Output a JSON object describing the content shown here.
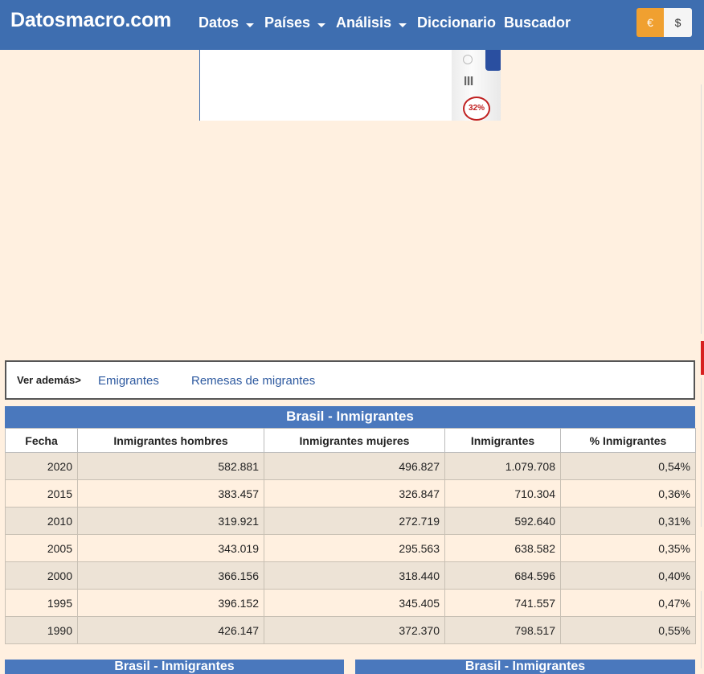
{
  "header": {
    "brand": "Datosmacro.com",
    "nav": [
      {
        "label": "Datos",
        "has_caret": true
      },
      {
        "label": "Países",
        "has_caret": true
      },
      {
        "label": "Análisis",
        "has_caret": true
      },
      {
        "label": "Diccionario",
        "has_caret": false
      },
      {
        "label": "Buscador",
        "has_caret": false
      }
    ],
    "currency": {
      "eur": "€",
      "usd": "$",
      "selected": "€"
    }
  },
  "ad": {
    "badge": "32%"
  },
  "see_also": {
    "label": "Ver además>",
    "links": [
      "Emigrantes",
      "Remesas de migrantes"
    ]
  },
  "table": {
    "title": "Brasil - Inmigrantes",
    "headers": [
      "Fecha",
      "Inmigrantes hombres",
      "Inmigrantes mujeres",
      "Inmigrantes",
      "% Inmigrantes"
    ],
    "rows": [
      [
        "2020",
        "582.881",
        "496.827",
        "1.079.708",
        "0,54%"
      ],
      [
        "2015",
        "383.457",
        "326.847",
        "710.304",
        "0,36%"
      ],
      [
        "2010",
        "319.921",
        "272.719",
        "592.640",
        "0,31%"
      ],
      [
        "2005",
        "343.019",
        "295.563",
        "638.582",
        "0,35%"
      ],
      [
        "2000",
        "366.156",
        "318.440",
        "684.596",
        "0,40%"
      ],
      [
        "1995",
        "396.152",
        "345.405",
        "741.557",
        "0,47%"
      ],
      [
        "1990",
        "426.147",
        "372.370",
        "798.517",
        "0,55%"
      ]
    ]
  },
  "bottom_panels": [
    "Brasil - Inmigrantes",
    "Brasil - Inmigrantes"
  ],
  "colors": {
    "header_bg": "#3e6eb0",
    "accent_orange": "#f0a030",
    "table_header_bg": "#4a78bd",
    "page_bg": "#fff0e0",
    "row_alt_bg": "#ede3d6",
    "link": "#2e5aa0"
  }
}
